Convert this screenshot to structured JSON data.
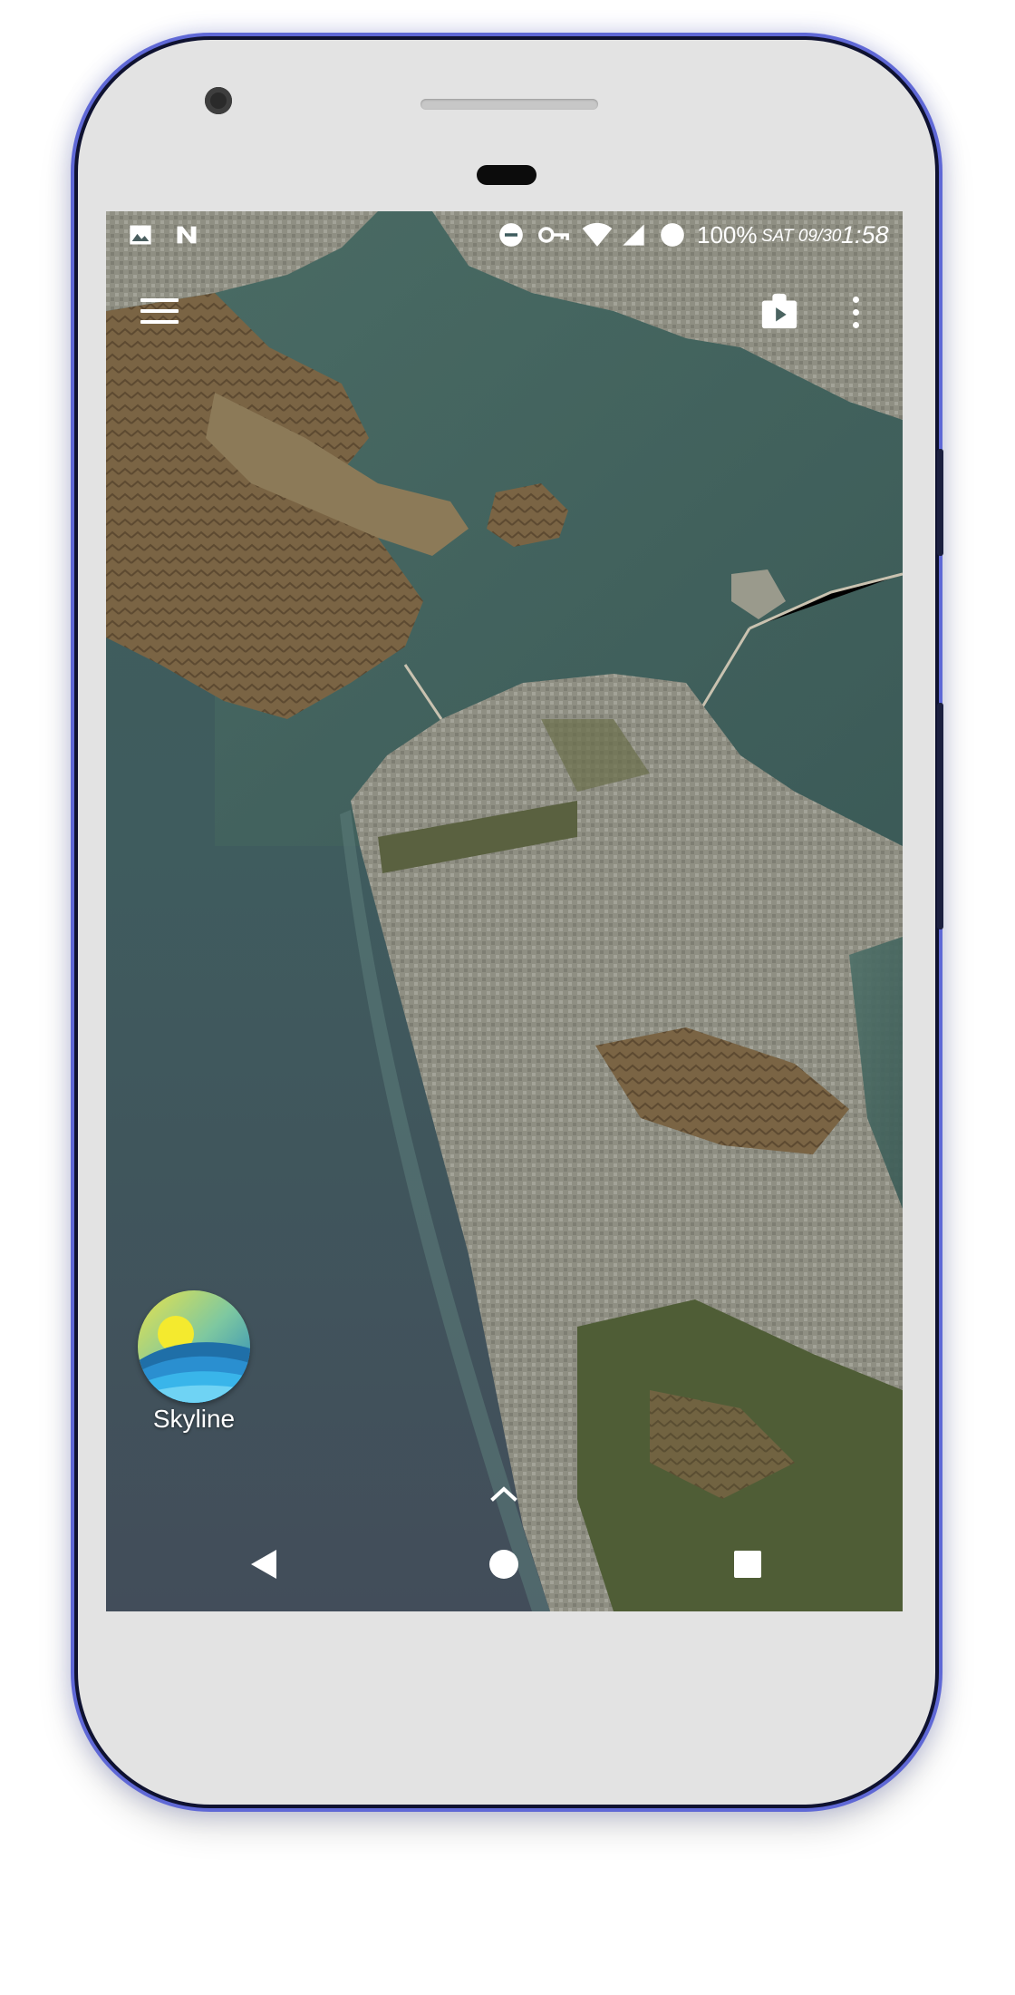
{
  "status_bar": {
    "left_icons": [
      "image-icon",
      "n-logo-icon"
    ],
    "right_icons": [
      "do-not-disturb-icon",
      "vpn-key-icon",
      "wifi-icon",
      "cell-signal-icon",
      "battery-icon"
    ],
    "battery": "100%",
    "date": "SAT 09/30",
    "time": "1:58"
  },
  "top_actions": {
    "left": "menu-icon",
    "right": [
      "play-store-icon",
      "more-vert-icon"
    ]
  },
  "wallpaper": {
    "description_icon": "satellite-map-wallpaper",
    "colors": {
      "water": "#4f6a68",
      "land": "#8a8a78",
      "hills": "#6f5d3e",
      "greenery": "#4c5a34"
    }
  },
  "home_shortcuts": [
    {
      "label": "Skyline",
      "icon": "skyline-app-icon"
    }
  ],
  "drawer_handle": "chevron-up-icon",
  "nav_bar": {
    "back": "back-icon",
    "home": "home-icon",
    "recents": "recents-icon"
  }
}
